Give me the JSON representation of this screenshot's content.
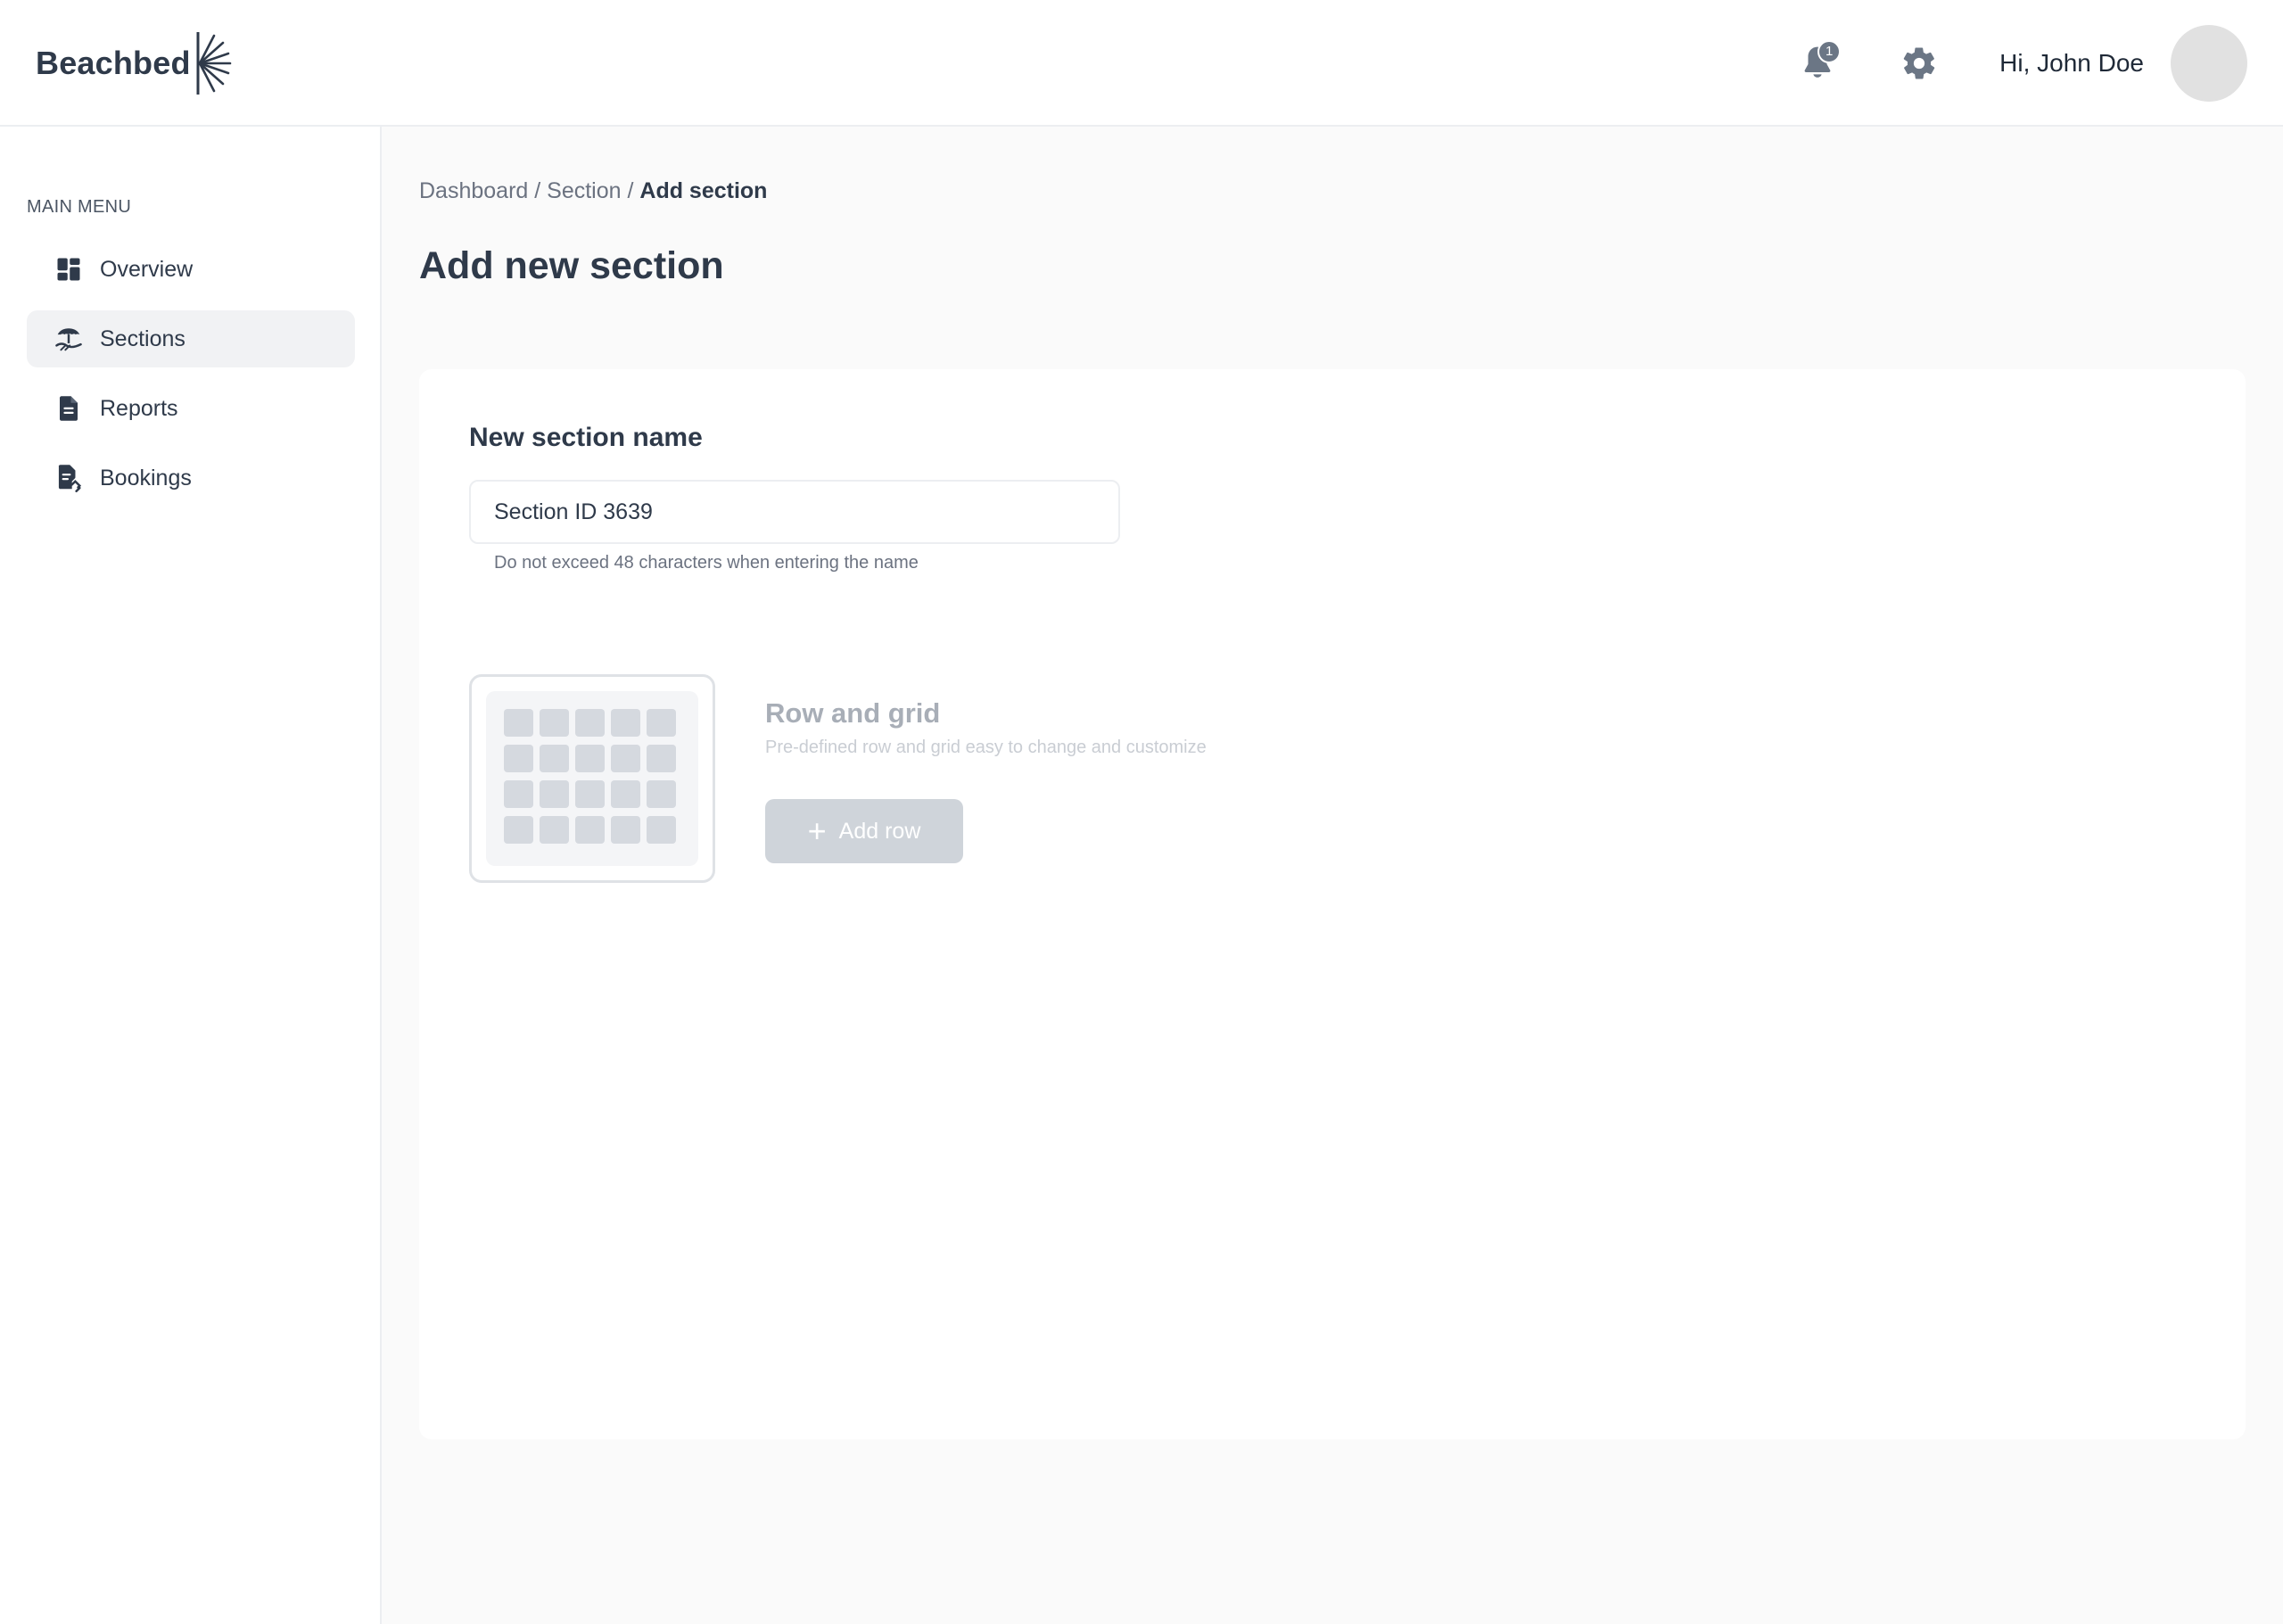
{
  "brand": {
    "name": "Beachbed"
  },
  "header": {
    "notification_count": "1",
    "greeting": "Hi, John Doe"
  },
  "sidebar": {
    "menu_title": "MAIN MENU",
    "items": [
      {
        "label": "Overview",
        "icon": "dashboard-icon"
      },
      {
        "label": "Sections",
        "icon": "beach-umbrella-icon",
        "active": true
      },
      {
        "label": "Reports",
        "icon": "document-icon"
      },
      {
        "label": "Bookings",
        "icon": "receipt-icon"
      }
    ]
  },
  "breadcrumb": {
    "dashboard": "Dashboard",
    "section": "Section",
    "current": "Add section",
    "separator": " / "
  },
  "page": {
    "title": "Add new section"
  },
  "form": {
    "name_label": "New section name",
    "name_value": "Section ID 3639",
    "name_hint": "Do not exceed 48 characters when entering the name"
  },
  "row_grid": {
    "title": "Row and grid",
    "description": "Pre-defined row and grid easy to change and customize",
    "add_row_label": "Add row"
  },
  "colors": {
    "text_primary": "#2f3a4a",
    "active_nav_bg": "#f1f2f4",
    "disabled_button": "#cfd4da",
    "page_bg": "#fafafa"
  }
}
